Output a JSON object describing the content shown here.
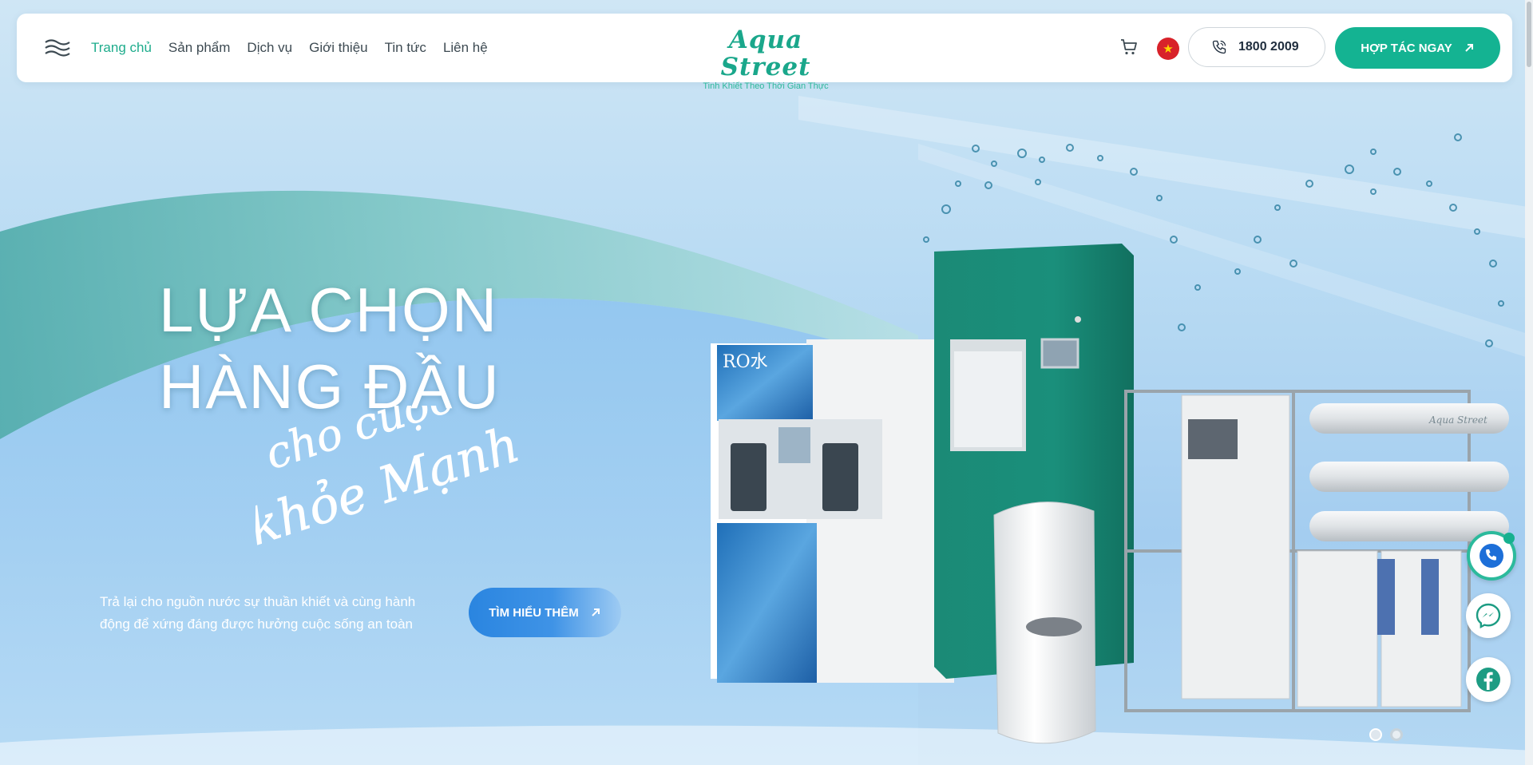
{
  "nav": {
    "items": [
      {
        "label": "Trang chủ",
        "active": true
      },
      {
        "label": "Sản phẩm"
      },
      {
        "label": "Dịch vụ"
      },
      {
        "label": "Giới thiệu"
      },
      {
        "label": "Tin tức"
      },
      {
        "label": "Liên hệ"
      }
    ]
  },
  "brand": {
    "name": "Aqua Street",
    "tagline": "Tinh Khiết Theo Thời Gian Thực",
    "accent": "#14b392"
  },
  "header": {
    "phone": "1800 2009",
    "cta_label": "HỢP TÁC NGAY",
    "language_flag": "vietnam-flag"
  },
  "hero": {
    "headline_line1": "LỰA CHỌN",
    "headline_line2": "HÀNG ĐẦU",
    "script_line1": "cho cuộc sống",
    "script_line2": "khỏe Mạnh",
    "description_line1": "Trả lại cho nguồn nước sự thuần khiết và cùng hành",
    "description_line2": "động để xứng đáng được hưởng cuộc sống an toàn",
    "button_label": "TÌM HIỂU THÊM",
    "machine_label_ro": "RO水",
    "machine_label_brand": "Aqua Street"
  },
  "slider": {
    "slides": 2,
    "current": 1
  },
  "social": [
    "zalo-icon",
    "messenger-icon",
    "facebook-icon"
  ]
}
